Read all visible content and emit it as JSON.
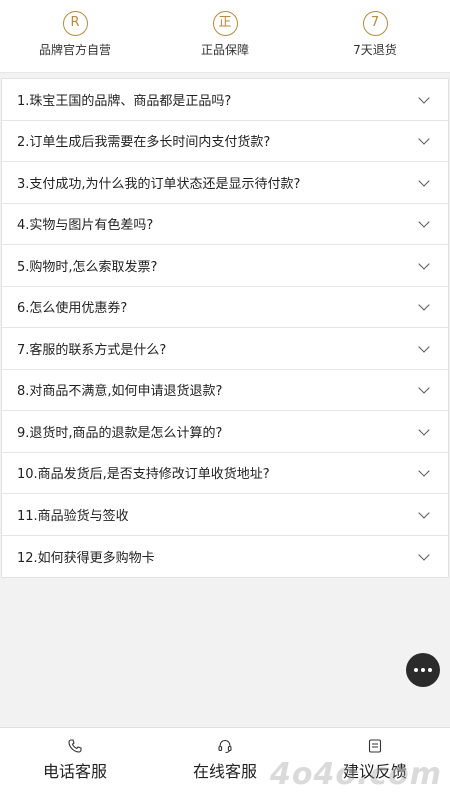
{
  "features": [
    {
      "icon_char": "R",
      "icon": "registered-icon",
      "label": "品牌官方自营"
    },
    {
      "icon_char": "正",
      "icon": "genuine-icon",
      "label": "正品保障"
    },
    {
      "icon_char": "7",
      "icon": "seven-day-icon",
      "label": "7天退货"
    }
  ],
  "faq": [
    {
      "q": "1.珠宝王国的品牌、商品都是正品吗?"
    },
    {
      "q": "2.订单生成后我需要在多长时间内支付货款?"
    },
    {
      "q": "3.支付成功,为什么我的订单状态还是显示待付款?"
    },
    {
      "q": "4.实物与图片有色差吗?"
    },
    {
      "q": "5.购物时,怎么索取发票?"
    },
    {
      "q": "6.怎么使用优惠券?"
    },
    {
      "q": "7.客服的联系方式是什么?"
    },
    {
      "q": "8.对商品不满意,如何申请退货退款?"
    },
    {
      "q": "9.退货时,商品的退款是怎么计算的?"
    },
    {
      "q": "10.商品发货后,是否支持修改订单收货地址?"
    },
    {
      "q": "11.商品验货与签收"
    },
    {
      "q": "12.如何获得更多购物卡"
    }
  ],
  "bottom_tabs": [
    {
      "label": "电话客服",
      "icon": "phone-icon"
    },
    {
      "label": "在线客服",
      "icon": "headset-icon"
    },
    {
      "label": "建议反馈",
      "icon": "feedback-icon"
    }
  ],
  "watermark": "4o4o.com",
  "colors": {
    "accent": "#b88a3e",
    "fab": "#2b2b2b"
  }
}
